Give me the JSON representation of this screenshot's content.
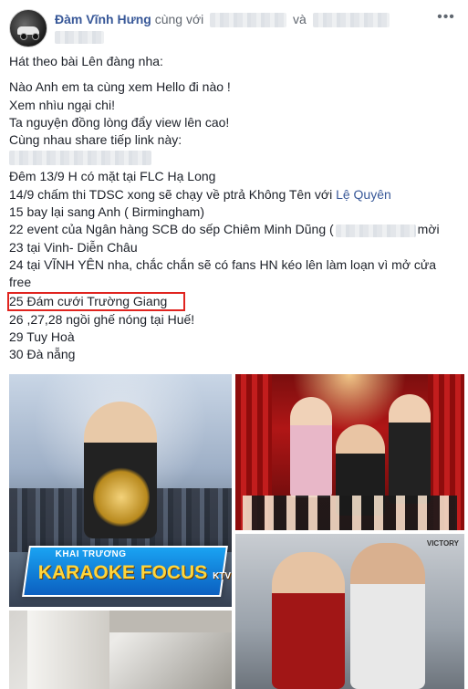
{
  "post": {
    "author": "Đàm Vĩnh Hưng",
    "with_text": "cùng với",
    "and_text": "và",
    "more_icon": "•••",
    "lines": [
      "Hát theo bài Lên đàng nha:",
      "Nào Anh em ta cùng xem Hello đi nào !",
      "Xem nhìu ngại chi!",
      "Ta nguyện đồng lòng đẩy view lên cao!",
      "Cùng nhau share tiếp link này:",
      "Đêm 13/9 H có mặt tại FLC Hạ Long",
      "14/9 chấm thi TDSC xong sẽ chạy về ptrả Không Tên với",
      "Lệ Quyên",
      "15 bay lại sang Anh ( Birmingham)",
      "22 event của Ngân hàng SCB do sếp Chiêm Minh Dũng (",
      "mời",
      "23 tại Vinh- Diễn Châu",
      "24 tại VĨNH YÊN nha, chắc chắn sẽ có fans HN kéo lên làm loạn vì mở cửa free",
      "25 Đám cưới Trường Giang",
      "26 ,27,28 ngồi ghế nóng tại Huế!",
      "29 Tuy Hoà",
      "30 Đà nẵng"
    ]
  },
  "photos": {
    "banner_small": "KHAI TRƯƠNG",
    "banner_big": "KARAOKE FOCUS",
    "banner_ktv": "KTV",
    "logo": "VICTORY"
  },
  "colors": {
    "link": "#385898",
    "highlight_border": "#e0241f",
    "text": "#1d2129"
  }
}
